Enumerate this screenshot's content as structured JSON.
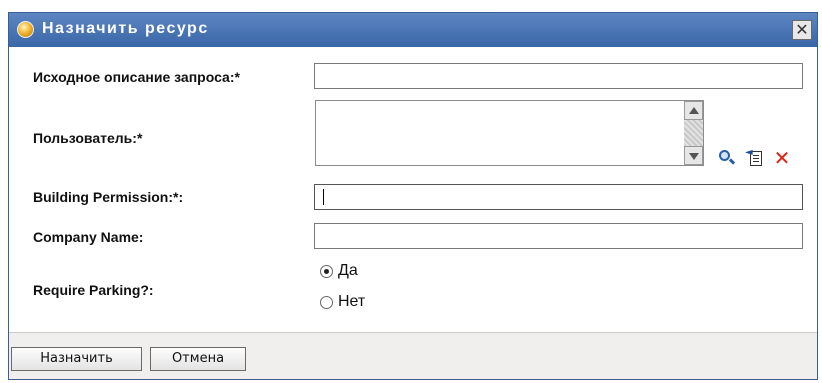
{
  "dialog": {
    "title": "Назначить ресурс",
    "close_symbol": "✕"
  },
  "form": {
    "request_description_label": "Исходное описание запроса:*",
    "request_description_value": "",
    "user_label": "Пользователь:*",
    "building_permission_label": "Building Permission:*:",
    "building_permission_value": "",
    "company_name_label": "Company Name:",
    "company_name_value": "",
    "require_parking_label": "Require Parking?:",
    "parking_options": [
      {
        "label": "Да",
        "selected": true
      },
      {
        "label": "Нет",
        "selected": false
      }
    ]
  },
  "user_actions": {
    "search_icon": "search-icon",
    "history_icon": "history-list-icon",
    "clear_icon": "clear-icon",
    "clear_symbol": "✕"
  },
  "footer": {
    "assign_label": "Назначить",
    "cancel_label": "Отмена"
  },
  "colors": {
    "titlebar": "#3b66a8",
    "footer_bg": "#f0efed",
    "clear_red": "#d8261a"
  }
}
